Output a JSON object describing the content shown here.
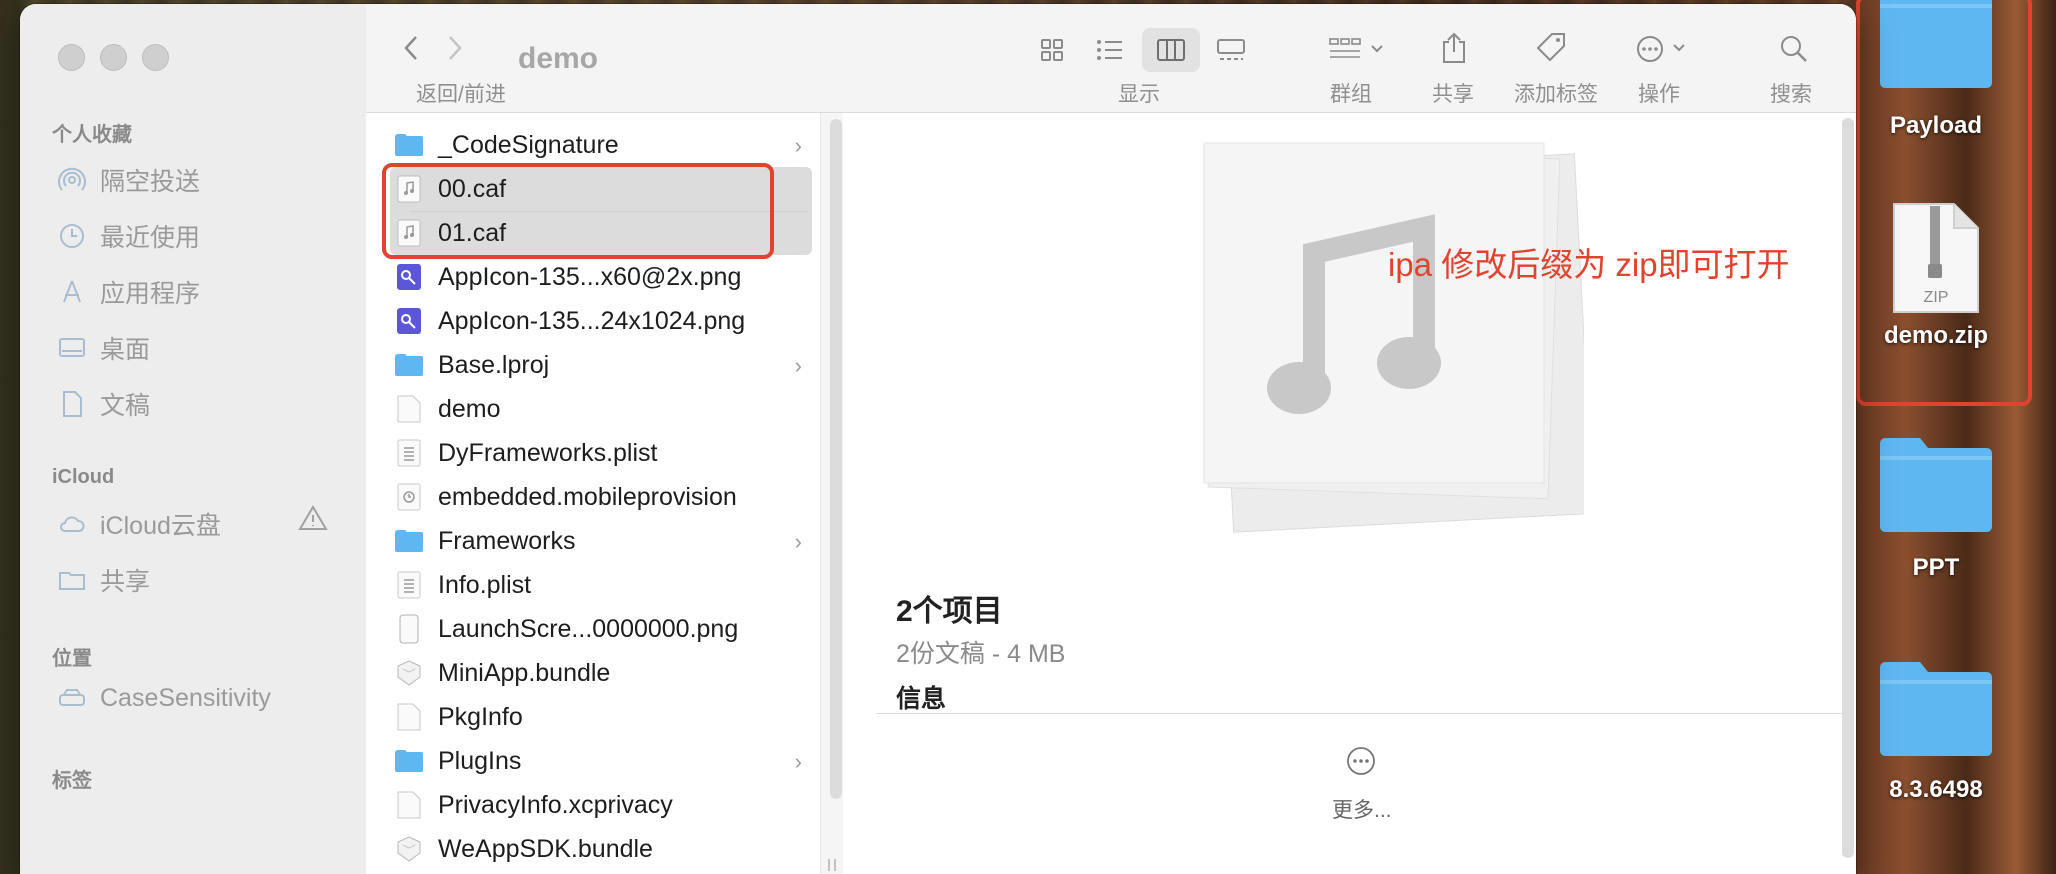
{
  "window": {
    "title": "demo",
    "nav_label": "返回/前进"
  },
  "toolbar": {
    "view_label": "显示",
    "group_label": "群组",
    "share_label": "共享",
    "tags_label": "添加标签",
    "action_label": "操作",
    "search_label": "搜索"
  },
  "sidebar": {
    "favorites_title": "个人收藏",
    "favorites": [
      {
        "label": "隔空投送",
        "icon": "airdrop-icon"
      },
      {
        "label": "最近使用",
        "icon": "clock-icon"
      },
      {
        "label": "应用程序",
        "icon": "applications-icon"
      },
      {
        "label": "桌面",
        "icon": "desktop-icon"
      },
      {
        "label": "文稿",
        "icon": "document-icon"
      }
    ],
    "icloud_title": "iCloud",
    "icloud": [
      {
        "label": "iCloud云盘",
        "icon": "cloud-icon"
      },
      {
        "label": "共享",
        "icon": "shared-folder-icon"
      }
    ],
    "locations_title": "位置",
    "locations": [
      {
        "label": "CaseSensitivity",
        "icon": "disk-icon"
      }
    ],
    "tags_title": "标签"
  },
  "files": [
    {
      "name": "_CodeSignature",
      "kind": "folder",
      "has_children": true
    },
    {
      "name": "00.caf",
      "kind": "audio",
      "selected": true
    },
    {
      "name": "01.caf",
      "kind": "audio",
      "selected": true
    },
    {
      "name": "AppIcon-135...x60@2x.png",
      "kind": "image"
    },
    {
      "name": "AppIcon-135...24x1024.png",
      "kind": "image"
    },
    {
      "name": "Base.lproj",
      "kind": "folder",
      "has_children": true
    },
    {
      "name": "demo",
      "kind": "file"
    },
    {
      "name": "DyFrameworks.plist",
      "kind": "plist"
    },
    {
      "name": "embedded.mobileprovision",
      "kind": "provision"
    },
    {
      "name": "Frameworks",
      "kind": "folder",
      "has_children": true
    },
    {
      "name": "Info.plist",
      "kind": "plist"
    },
    {
      "name": "LaunchScre...0000000.png",
      "kind": "image-phone"
    },
    {
      "name": "MiniApp.bundle",
      "kind": "bundle"
    },
    {
      "name": "PkgInfo",
      "kind": "file"
    },
    {
      "name": "PlugIns",
      "kind": "folder",
      "has_children": true
    },
    {
      "name": "PrivacyInfo.xcprivacy",
      "kind": "file"
    },
    {
      "name": "WeAppSDK.bundle",
      "kind": "bundle"
    }
  ],
  "preview": {
    "annotation": "ipa 修改后缀为 zip即可打开",
    "count": "2个项目",
    "subtitle": "2份文稿 - 4 MB",
    "info_title": "信息",
    "more_label": "更多..."
  },
  "desktop": [
    {
      "label": "Payload",
      "icon": "folder-icon"
    },
    {
      "label": "demo.zip",
      "icon": "zip-file-icon",
      "badge": "ZIP"
    },
    {
      "label": "PPT",
      "icon": "folder-icon"
    },
    {
      "label": "8.3.6498",
      "icon": "folder-icon"
    }
  ],
  "colors": {
    "annotation_red": "#e0442e",
    "folder_blue": "#5fb7f2",
    "selection_gray": "#dcdcdc"
  }
}
